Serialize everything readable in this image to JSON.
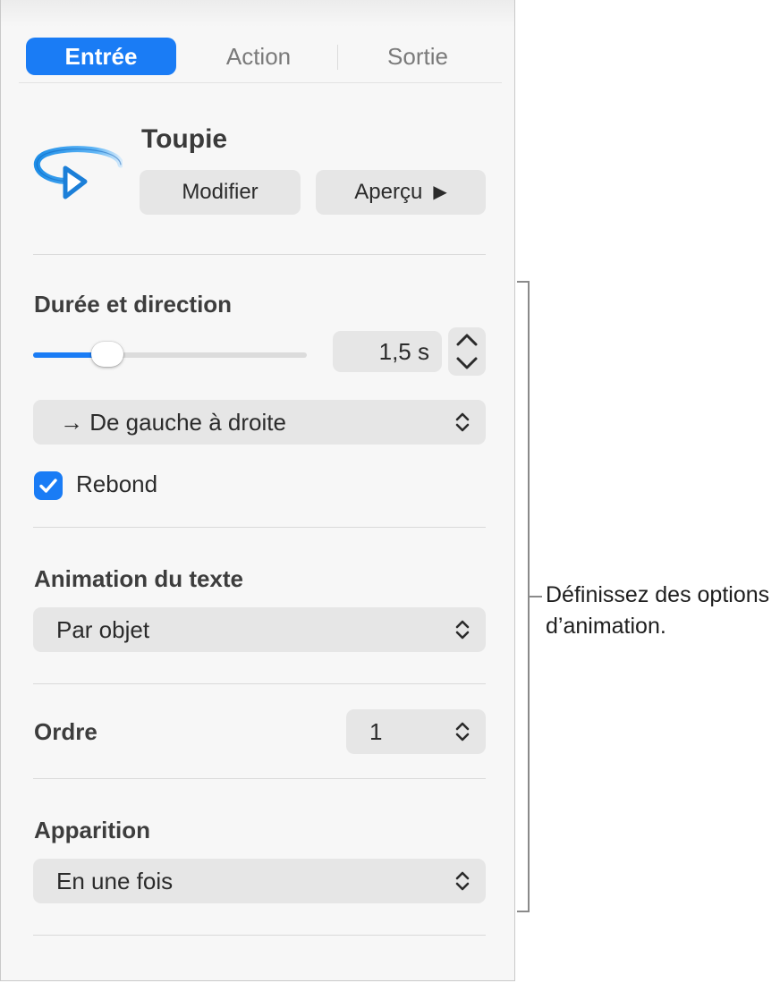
{
  "tabs": [
    {
      "label": "Entrée",
      "active": true
    },
    {
      "label": "Action",
      "active": false
    },
    {
      "label": "Sortie",
      "active": false
    }
  ],
  "effect": {
    "name": "Toupie",
    "icon": "spin-arrow-icon",
    "modify_label": "Modifier",
    "preview_label": "Aperçu",
    "preview_icon": "play-icon"
  },
  "duration": {
    "title": "Durée et direction",
    "slider_fraction": 0.27,
    "value": "1,5 s",
    "direction": "→ De gauche à droite",
    "bounce_label": "Rebond",
    "bounce_checked": true
  },
  "text_animation": {
    "title": "Animation du texte",
    "value": "Par objet"
  },
  "order": {
    "title": "Ordre",
    "value": "1"
  },
  "appearance": {
    "title": "Apparition",
    "value": "En une fois"
  },
  "callout": {
    "text": "Définissez des options d’animation."
  },
  "colors": {
    "accent": "#1a7cf5",
    "panel_bg": "#f7f7f7",
    "control_bg": "#e6e6e6"
  }
}
